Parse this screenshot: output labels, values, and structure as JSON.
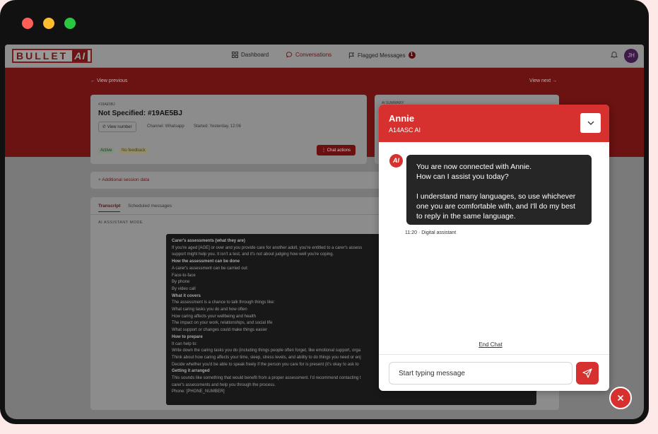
{
  "window": {
    "controls": [
      {
        "name": "close",
        "color": "#ff5f57"
      },
      {
        "name": "minimize",
        "color": "#febc2e"
      },
      {
        "name": "maximize",
        "color": "#28c840"
      }
    ]
  },
  "nav": {
    "logo_text": "BULLET",
    "logo_ai": "AI",
    "items": [
      {
        "label": "Dashboard",
        "icon": "grid-icon"
      },
      {
        "label": "Conversations",
        "icon": "chat-bubble-icon"
      },
      {
        "label": "Flagged Messages",
        "icon": "flag-icon",
        "badge": "1"
      }
    ],
    "avatar_initials": "JH"
  },
  "session": {
    "view_previous": "← View previous",
    "view_next": "View next →",
    "id_small": "#19AE5BJ",
    "title": "Not Specified: #19AE5BJ",
    "view_number": "View number",
    "channel": "Channel: Whatsapp",
    "started": "Started: Yesterday, 12:06",
    "status_active": "Active",
    "status_feedback": "No feedback",
    "chat_actions": "Chat actions",
    "summary_label": "AI SUMMARY",
    "additional": "+ Additional session data"
  },
  "tabs": {
    "transcript": "Transcript",
    "scheduled": "Scheduled messages",
    "mode": "AI ASSISTANT MODE"
  },
  "transcript_lines": [
    {
      "t": "Carer's assessments (what they are)",
      "b": true
    },
    {
      "t": "If you're aged [AGE] or over and you provide care for another adult, you're entitled to a carer's assess",
      "b": false
    },
    {
      "t": "support might help you. It isn't a test, and it's not about judging how well you're coping.",
      "b": false
    },
    {
      "t": "How the assessment can be done",
      "b": true
    },
    {
      "t": "A carer's assessment can be carried out:",
      "b": false
    },
    {
      "t": "Face-to-face",
      "b": false
    },
    {
      "t": "By phone",
      "b": false
    },
    {
      "t": "By video call",
      "b": false
    },
    {
      "t": "What it covers",
      "b": true
    },
    {
      "t": "The assessment is a chance to talk through things like:",
      "b": false
    },
    {
      "t": "What caring tasks you do and how often",
      "b": false
    },
    {
      "t": "How caring affects your wellbeing and health",
      "b": false
    },
    {
      "t": "The impact on your work, relationships, and social life",
      "b": false
    },
    {
      "t": "What support or changes could make things easier",
      "b": false
    },
    {
      "t": "How to prepare",
      "b": true
    },
    {
      "t": "It can help to:",
      "b": false
    },
    {
      "t": "Write down the caring tasks you do (including things people often forget, like emotional support, orga",
      "b": false
    },
    {
      "t": "Think about how caring affects your time, sleep, stress levels, and ability to do things you need or enj",
      "b": false
    },
    {
      "t": "Decide whether you'd be able to speak freely if the person you care for is present (it's okay to ask to",
      "b": false
    },
    {
      "t": "Getting it arranged",
      "b": true
    },
    {
      "t": "This sounds like something that would benefit from a proper assessment. I'd recommend contacting t",
      "b": false
    },
    {
      "t": "carer's assessments and help you through the process.",
      "b": false
    },
    {
      "t": "Phone: [PHONE_NUMBER]",
      "b": false
    }
  ],
  "chat": {
    "name": "Annie",
    "subtitle": "A14ASC AI",
    "bot_avatar": "AI",
    "message_line1": "You are now connected with Annie.",
    "message_line2": "How can I assist you today?",
    "message_para2": "I understand many languages, so use whichever one you are comfortable with, and I'll do my best to reply in the same language.",
    "time": "11:20",
    "sender": "Digital assistant",
    "end_chat": "End Chat",
    "input_placeholder": "Start typing message"
  },
  "colors": {
    "brand_red": "#d6312e",
    "dark_bubble": "#262626"
  }
}
